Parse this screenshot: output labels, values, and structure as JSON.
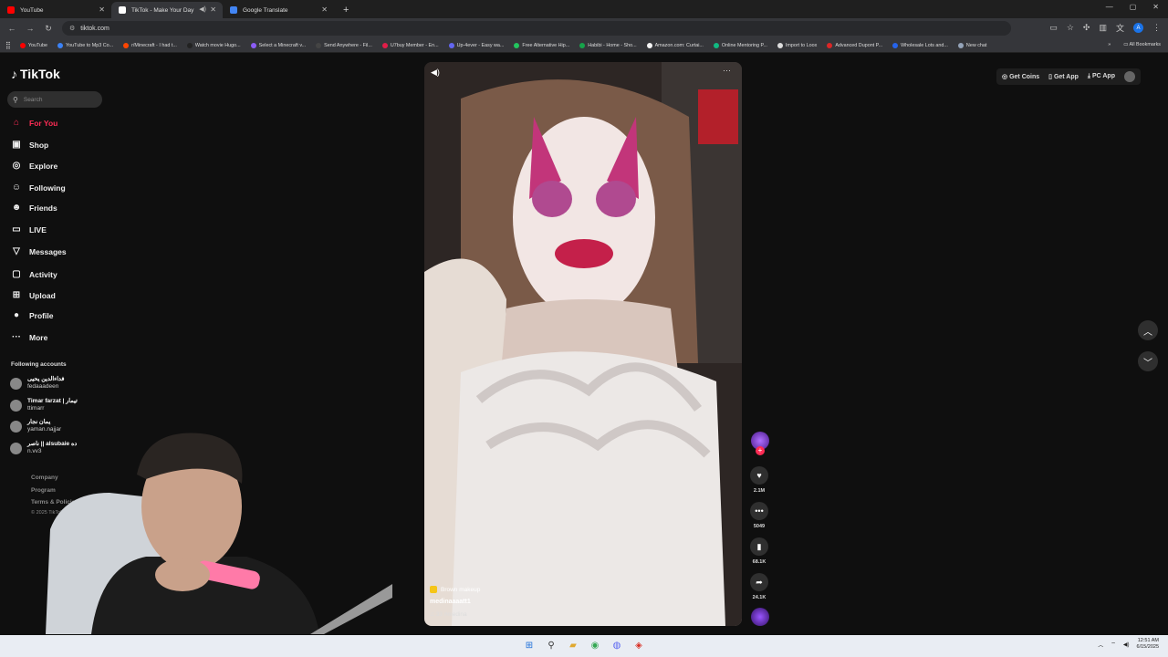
{
  "browser": {
    "tabs": [
      {
        "title": "YouTube",
        "favicon_color": "#ff0000",
        "active": false
      },
      {
        "title": "TikTok - Make Your Day",
        "favicon_color": "#ffffff",
        "active": true
      },
      {
        "title": "Google Translate",
        "favicon_color": "#4285f4",
        "active": false
      }
    ],
    "url": "tiktok.com",
    "bookmarks": [
      {
        "label": "YouTube",
        "color": "#ff0000"
      },
      {
        "label": "YouTube to Mp3 Co...",
        "color": "#3b82f6"
      },
      {
        "label": "r/Minecraft - I had t...",
        "color": "#ff4500"
      },
      {
        "label": "Watch movie Hugo...",
        "color": "#222222"
      },
      {
        "label": "Select a Minecraft v...",
        "color": "#8b5cf6"
      },
      {
        "label": "Send Anywhere - Fil...",
        "color": "#444444"
      },
      {
        "label": "U7buy Member - En...",
        "color": "#e11d48"
      },
      {
        "label": "Up-4ever - Easy wa...",
        "color": "#6366f1"
      },
      {
        "label": "Free Alternative Hip...",
        "color": "#22c55e"
      },
      {
        "label": "Habibi - Home - Sho...",
        "color": "#16a34a"
      },
      {
        "label": "Amazon.com: Curtai...",
        "color": "#f5f5f5"
      },
      {
        "label": "Online Mentoring P...",
        "color": "#10b981"
      },
      {
        "label": "Import to Loox",
        "color": "#dddddd"
      },
      {
        "label": "Advanced Dupont P...",
        "color": "#dc2626"
      },
      {
        "label": "Wholesale Lots and...",
        "color": "#2563eb"
      },
      {
        "label": "New chat",
        "color": "#94a3b8"
      }
    ],
    "all_bookmarks": "All Bookmarks",
    "profile_initial": "A"
  },
  "tiktok": {
    "logo": "TikTok",
    "search_placeholder": "Search",
    "nav": [
      {
        "label": "For You",
        "icon": "home-icon",
        "glyph": "⌂"
      },
      {
        "label": "Shop",
        "icon": "shop-icon",
        "glyph": "▣"
      },
      {
        "label": "Explore",
        "icon": "compass-icon",
        "glyph": "◎"
      },
      {
        "label": "Following",
        "icon": "user-icon",
        "glyph": "☺"
      },
      {
        "label": "Friends",
        "icon": "friends-icon",
        "glyph": "☻"
      },
      {
        "label": "LIVE",
        "icon": "live-icon",
        "glyph": "▭"
      },
      {
        "label": "Messages",
        "icon": "send-icon",
        "glyph": "▽"
      },
      {
        "label": "Activity",
        "icon": "activity-icon",
        "glyph": "▢"
      },
      {
        "label": "Upload",
        "icon": "upload-icon",
        "glyph": "⊞"
      },
      {
        "label": "Profile",
        "icon": "profile-icon",
        "glyph": "●"
      },
      {
        "label": "More",
        "icon": "more-icon",
        "glyph": "···"
      }
    ],
    "following_header": "Following accounts",
    "accounts": [
      {
        "name": "فداءالدين يحيى",
        "username": "fedaaadeen"
      },
      {
        "name": "Timar farzat | تيمار",
        "username": "ttimarr"
      },
      {
        "name": "يمان نجار",
        "username": "yaman.najjar"
      },
      {
        "name": "ناصر || alsubaie ده",
        "username": "n.vv3"
      }
    ],
    "footer": [
      "Company",
      "Program",
      "Terms & Policies"
    ],
    "copyright": "© 2025 TikTok",
    "top_actions": {
      "coins": "Get Coins",
      "app": "Get App",
      "pc": "PC App"
    },
    "video": {
      "tag": "Brown makeup",
      "author": "medinaaaatt1",
      "caption": "33 #medina"
    },
    "actions": [
      {
        "icon": "heart-icon",
        "glyph": "♥",
        "count": "2.1M"
      },
      {
        "icon": "comment-icon",
        "glyph": "•••",
        "count": "5049"
      },
      {
        "icon": "bookmark-icon",
        "glyph": "▮",
        "count": "68.1K"
      },
      {
        "icon": "share-icon",
        "glyph": "➦",
        "count": "24.1K"
      }
    ]
  },
  "system": {
    "time": "12:51 AM",
    "date": "6/15/2025"
  }
}
